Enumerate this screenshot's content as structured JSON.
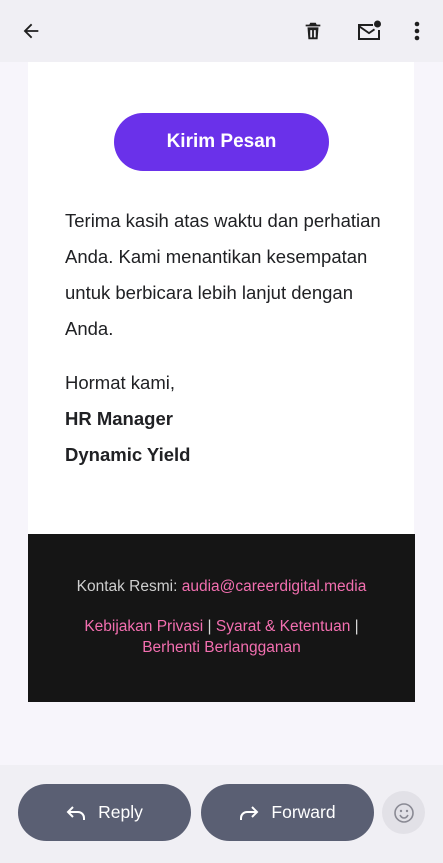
{
  "toolbar": {
    "back_icon": "arrow-back-icon",
    "delete_icon": "trash-icon",
    "mark_unread_icon": "mail-badge-icon",
    "more_icon": "more-vert-icon"
  },
  "email": {
    "cta_label": "Kirim Pesan",
    "cta_color": "#6a31ea",
    "paragraph": "Terima kasih atas waktu dan perhatian Anda. Kami menantikan kesempatan untuk berbicara lebih lanjut dengan Anda.",
    "closing": "Hormat kami,",
    "signature_title": "HR Manager",
    "signature_company": "Dynamic Yield"
  },
  "footer": {
    "contact_label": "Kontak Resmi:",
    "contact_email": "audia@careerdigital.media",
    "privacy_link": "Kebijakan Privasi",
    "terms_link": "Syarat & Ketentuan",
    "unsubscribe_link": "Berhenti Berlangganan",
    "separator": "|",
    "link_color": "#f36fb0"
  },
  "actions": {
    "reply_label": "Reply",
    "forward_label": "Forward",
    "reply_icon": "reply-icon",
    "forward_icon": "forward-icon",
    "emoji_icon": "emoji-icon"
  }
}
